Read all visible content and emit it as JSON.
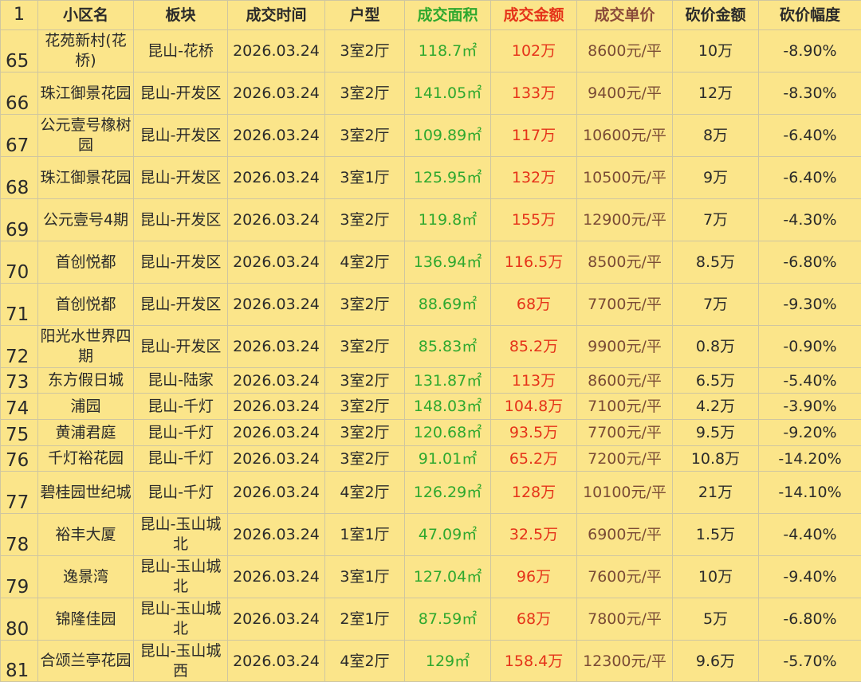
{
  "header": {
    "rownum": "1",
    "columns": [
      "小区名",
      "板块",
      "成交时间",
      "户型",
      "成交面积",
      "成交金额",
      "成交单价",
      "砍价金额",
      "砍价幅度"
    ]
  },
  "colors": {
    "area": "#2ea82e",
    "amount": "#e53319",
    "unit_price": "#7a4b35",
    "background": "#fbe58a"
  },
  "rows": [
    {
      "num": "65",
      "name": "花苑新村(花桥)",
      "block": "昆山-花桥",
      "date": "2026.03.24",
      "layout": "3室2厅",
      "area": "118.7㎡",
      "amount": "102万",
      "unit": "8600元/平",
      "cut": "10万",
      "pct": "-8.90%"
    },
    {
      "num": "66",
      "name": "珠江御景花园",
      "block": "昆山-开发区",
      "date": "2026.03.24",
      "layout": "3室2厅",
      "area": "141.05㎡",
      "amount": "133万",
      "unit": "9400元/平",
      "cut": "12万",
      "pct": "-8.30%"
    },
    {
      "num": "67",
      "name": "公元壹号橡树园",
      "block": "昆山-开发区",
      "date": "2026.03.24",
      "layout": "3室2厅",
      "area": "109.89㎡",
      "amount": "117万",
      "unit": "10600元/平",
      "cut": "8万",
      "pct": "-6.40%"
    },
    {
      "num": "68",
      "name": "珠江御景花园",
      "block": "昆山-开发区",
      "date": "2026.03.24",
      "layout": "3室1厅",
      "area": "125.95㎡",
      "amount": "132万",
      "unit": "10500元/平",
      "cut": "9万",
      "pct": "-6.40%"
    },
    {
      "num": "69",
      "name": "公元壹号4期",
      "block": "昆山-开发区",
      "date": "2026.03.24",
      "layout": "3室2厅",
      "area": "119.8㎡",
      "amount": "155万",
      "unit": "12900元/平",
      "cut": "7万",
      "pct": "-4.30%"
    },
    {
      "num": "70",
      "name": "首创悦都",
      "block": "昆山-开发区",
      "date": "2026.03.24",
      "layout": "4室2厅",
      "area": "136.94㎡",
      "amount": "116.5万",
      "unit": "8500元/平",
      "cut": "8.5万",
      "pct": "-6.80%"
    },
    {
      "num": "71",
      "name": "首创悦都",
      "block": "昆山-开发区",
      "date": "2026.03.24",
      "layout": "3室2厅",
      "area": "88.69㎡",
      "amount": "68万",
      "unit": "7700元/平",
      "cut": "7万",
      "pct": "-9.30%"
    },
    {
      "num": "72",
      "name": "阳光水世界四期",
      "block": "昆山-开发区",
      "date": "2026.03.24",
      "layout": "3室2厅",
      "area": "85.83㎡",
      "amount": "85.2万",
      "unit": "9900元/平",
      "cut": "0.8万",
      "pct": "-0.90%"
    },
    {
      "num": "73",
      "name": "东方假日城",
      "block": "昆山-陆家",
      "date": "2026.03.24",
      "layout": "3室2厅",
      "area": "131.87㎡",
      "amount": "113万",
      "unit": "8600元/平",
      "cut": "6.5万",
      "pct": "-5.40%"
    },
    {
      "num": "74",
      "name": "浦园",
      "block": "昆山-千灯",
      "date": "2026.03.24",
      "layout": "3室2厅",
      "area": "148.03㎡",
      "amount": "104.8万",
      "unit": "7100元/平",
      "cut": "4.2万",
      "pct": "-3.90%"
    },
    {
      "num": "75",
      "name": "黄浦君庭",
      "block": "昆山-千灯",
      "date": "2026.03.24",
      "layout": "3室2厅",
      "area": "120.68㎡",
      "amount": "93.5万",
      "unit": "7700元/平",
      "cut": "9.5万",
      "pct": "-9.20%"
    },
    {
      "num": "76",
      "name": "千灯裕花园",
      "block": "昆山-千灯",
      "date": "2026.03.24",
      "layout": "3室2厅",
      "area": "91.01㎡",
      "amount": "65.2万",
      "unit": "7200元/平",
      "cut": "10.8万",
      "pct": "-14.20%"
    },
    {
      "num": "77",
      "name": "碧桂园世纪城",
      "block": "昆山-千灯",
      "date": "2026.03.24",
      "layout": "4室2厅",
      "area": "126.29㎡",
      "amount": "128万",
      "unit": "10100元/平",
      "cut": "21万",
      "pct": "-14.10%"
    },
    {
      "num": "78",
      "name": "裕丰大厦",
      "block": "昆山-玉山城北",
      "date": "2026.03.24",
      "layout": "1室1厅",
      "area": "47.09㎡",
      "amount": "32.5万",
      "unit": "6900元/平",
      "cut": "1.5万",
      "pct": "-4.40%"
    },
    {
      "num": "79",
      "name": "逸景湾",
      "block": "昆山-玉山城北",
      "date": "2026.03.24",
      "layout": "3室1厅",
      "area": "127.04㎡",
      "amount": "96万",
      "unit": "7600元/平",
      "cut": "10万",
      "pct": "-9.40%"
    },
    {
      "num": "80",
      "name": "锦隆佳园",
      "block": "昆山-玉山城北",
      "date": "2026.03.24",
      "layout": "2室1厅",
      "area": "87.59㎡",
      "amount": "68万",
      "unit": "7800元/平",
      "cut": "5万",
      "pct": "-6.80%"
    },
    {
      "num": "81",
      "name": "合颂兰亭花园",
      "block": "昆山-玉山城西",
      "date": "2026.03.24",
      "layout": "4室2厅",
      "area": "129㎡",
      "amount": "158.4万",
      "unit": "12300元/平",
      "cut": "9.6万",
      "pct": "-5.70%"
    }
  ]
}
